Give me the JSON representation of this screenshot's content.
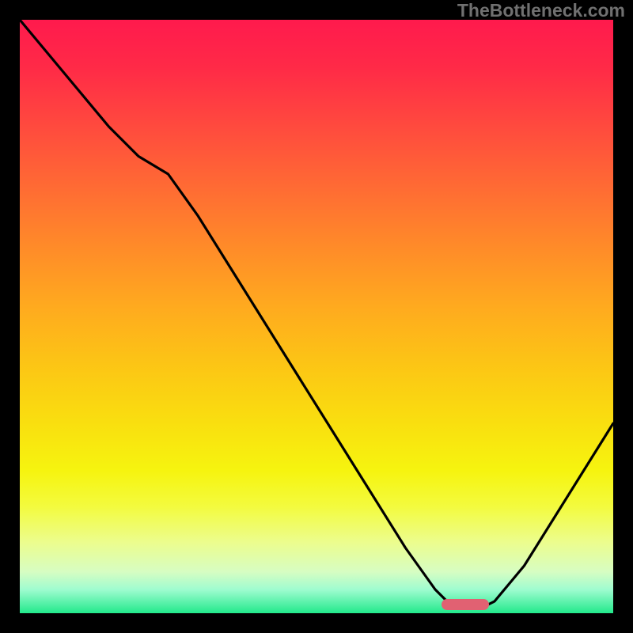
{
  "watermark": "TheBottleneck.com",
  "chart_data": {
    "type": "line",
    "title": "",
    "xlabel": "",
    "ylabel": "",
    "xlim": [
      0,
      100
    ],
    "ylim": [
      0,
      100
    ],
    "grid": false,
    "series": [
      {
        "name": "curve",
        "x": [
          0,
          5,
          10,
          15,
          20,
          25,
          30,
          35,
          40,
          45,
          50,
          55,
          60,
          65,
          70,
          72,
          75,
          78,
          80,
          85,
          90,
          95,
          100
        ],
        "values": [
          100,
          94,
          88,
          82,
          77,
          74,
          67,
          59,
          51,
          43,
          35,
          27,
          19,
          11,
          4,
          2,
          1,
          1,
          2,
          8,
          16,
          24,
          32
        ]
      }
    ],
    "marker": {
      "x_start": 71,
      "x_end": 79,
      "y": 1.5,
      "color": "#e16172"
    },
    "gradient_stops": [
      {
        "pos": 0,
        "color": "#ff1a4d"
      },
      {
        "pos": 50,
        "color": "#ffa91f"
      },
      {
        "pos": 80,
        "color": "#f6f40f"
      },
      {
        "pos": 100,
        "color": "#22e98b"
      }
    ]
  }
}
